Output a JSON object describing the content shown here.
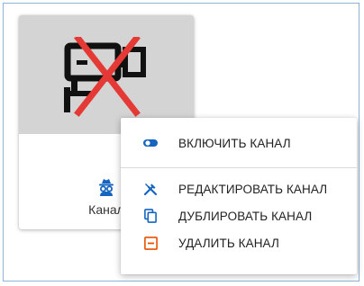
{
  "card": {
    "name": "Канал",
    "preview_icon": "camera-off-icon",
    "owner_icon": "incognito-icon"
  },
  "context_menu": {
    "items": [
      {
        "label": "ВКЛЮЧИТЬ КАНАЛ",
        "icon": "toggle-icon",
        "color": "#1565c0"
      },
      {
        "label": "РЕДАКТИРОВАТЬ КАНАЛ",
        "icon": "tools-icon",
        "color": "#1565c0"
      },
      {
        "label": "ДУБЛИРОВАТЬ КАНАЛ",
        "icon": "copy-icon",
        "color": "#1565c0"
      },
      {
        "label": "УДАЛИТЬ КАНАЛ",
        "icon": "delete-icon",
        "color": "#e65100"
      }
    ]
  },
  "colors": {
    "accent": "#1565c0",
    "danger": "#e65100",
    "cross": "#e53935"
  }
}
